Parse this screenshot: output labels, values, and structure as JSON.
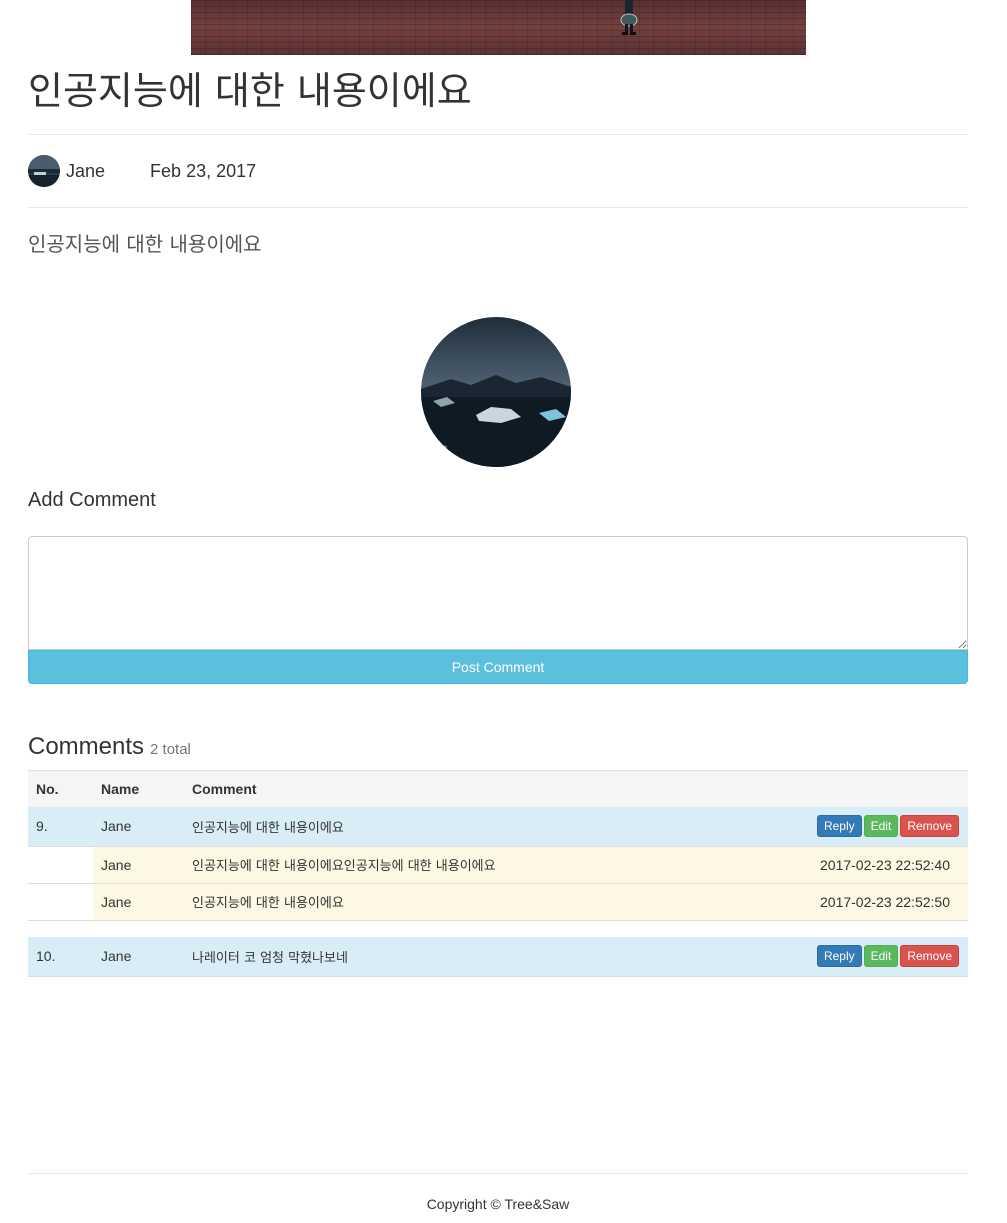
{
  "post": {
    "title": "인공지능에 대한 내용이에요",
    "author": "Jane",
    "date": "Feb 23, 2017",
    "body": "인공지능에 대한 내용이에요"
  },
  "add_comment": {
    "heading": "Add Comment",
    "textarea_value": "",
    "post_button_label": "Post Comment"
  },
  "comments": {
    "heading": "Comments",
    "total_label": "2 total",
    "columns": [
      "No.",
      "Name",
      "Comment"
    ],
    "buttons": {
      "reply": "Reply",
      "edit": "Edit",
      "remove": "Remove"
    },
    "threads": [
      {
        "no": "9.",
        "name": "Jane",
        "comment": "인공지능에 대한 내용이에요",
        "replies": [
          {
            "name": "Jane",
            "comment": "인공지능에 대한 내용이에요인공지능에 대한 내용이에요",
            "time": "2017-02-23 22:52:40"
          },
          {
            "name": "Jane",
            "comment": "인공지능에 대한 내용이에요",
            "time": "2017-02-23 22:52:50"
          }
        ]
      },
      {
        "no": "10.",
        "name": "Jane",
        "comment": "나레이터 코 엄청 막혔나보네",
        "replies": []
      }
    ]
  },
  "footer": {
    "copyright": "Copyright © Tree&Saw"
  },
  "colors": {
    "accent_info": "#5bc0de",
    "reply_button": "#337ab7",
    "edit_button": "#5cb85c",
    "remove_button": "#d9534f",
    "row_main": "#d9edf7",
    "row_reply": "#fcf8e3"
  }
}
